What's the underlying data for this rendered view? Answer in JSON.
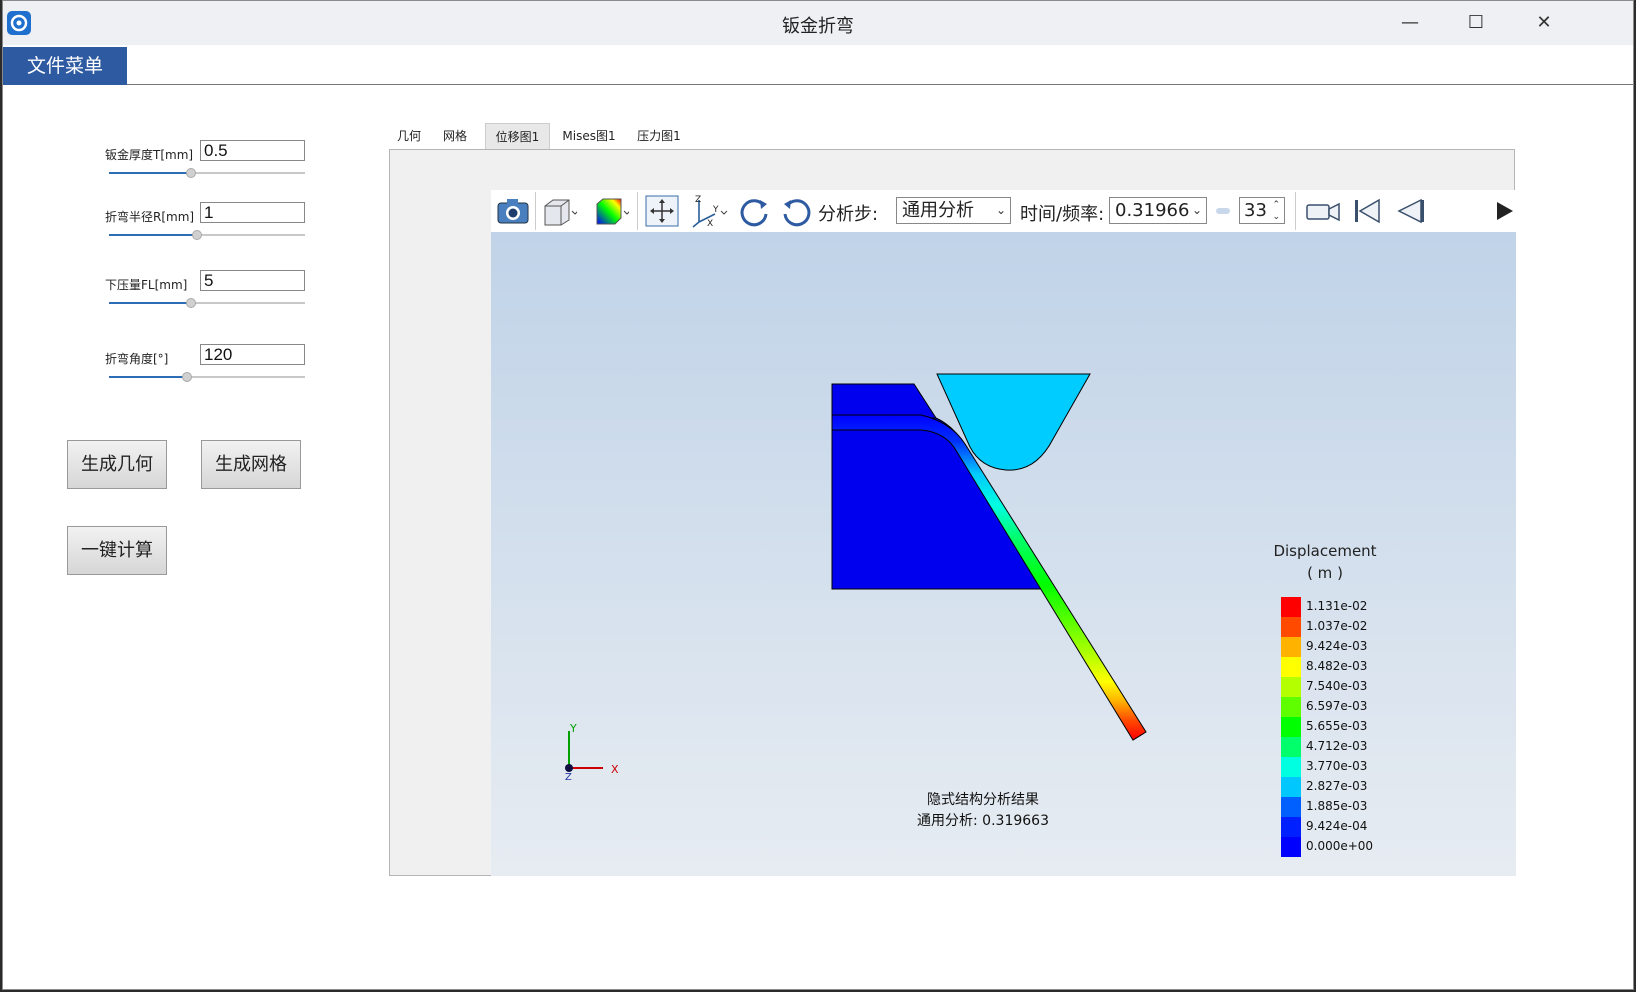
{
  "window": {
    "title": "钣金折弯"
  },
  "menu": {
    "file_menu": "文件菜单"
  },
  "params": [
    {
      "label": "钣金厚度T[mm]",
      "value": "0.5",
      "slider_fraction": 0.42
    },
    {
      "label": "折弯半径R[mm]",
      "value": "1",
      "slider_fraction": 0.45
    },
    {
      "label": "下压量FL[mm]",
      "value": "5",
      "slider_fraction": 0.42
    },
    {
      "label": "折弯角度[°]",
      "value": "120",
      "slider_fraction": 0.4
    }
  ],
  "buttons": {
    "gen_geometry": "生成几何",
    "gen_mesh": "生成网格",
    "compute": "一键计算"
  },
  "tabs": [
    "几何",
    "网格",
    "位移图1",
    "Mises图1",
    "压力图1"
  ],
  "active_tab": "位移图1",
  "toolbar": {
    "step_label": "分析步:",
    "step_value": "通用分析",
    "time_label": "时间/频率:",
    "time_value": "0.31966",
    "frame_value": "33"
  },
  "legend": {
    "title": "Displacement",
    "unit": "( m )",
    "labels": [
      "1.131e-02",
      "1.037e-02",
      "9.424e-03",
      "8.482e-03",
      "7.540e-03",
      "6.597e-03",
      "5.655e-03",
      "4.712e-03",
      "3.770e-03",
      "2.827e-03",
      "1.885e-03",
      "9.424e-04",
      "0.000e+00"
    ],
    "colors": [
      "#ff0000",
      "#ff4a00",
      "#ffb300",
      "#ffff00",
      "#b4ff00",
      "#5fff00",
      "#00ff00",
      "#00ff6a",
      "#00ffe0",
      "#00c8ff",
      "#0060ff",
      "#0020ff",
      "#0000ff"
    ]
  },
  "caption": {
    "line1": "隐式结构分析结果",
    "line2": "通用分析: 0.319663"
  },
  "axes": {
    "x": "X",
    "y": "Y",
    "z": "Z"
  },
  "colors": {
    "die": "#0000ee",
    "punch": "#00ccff",
    "menu": "#2d5aa1"
  }
}
